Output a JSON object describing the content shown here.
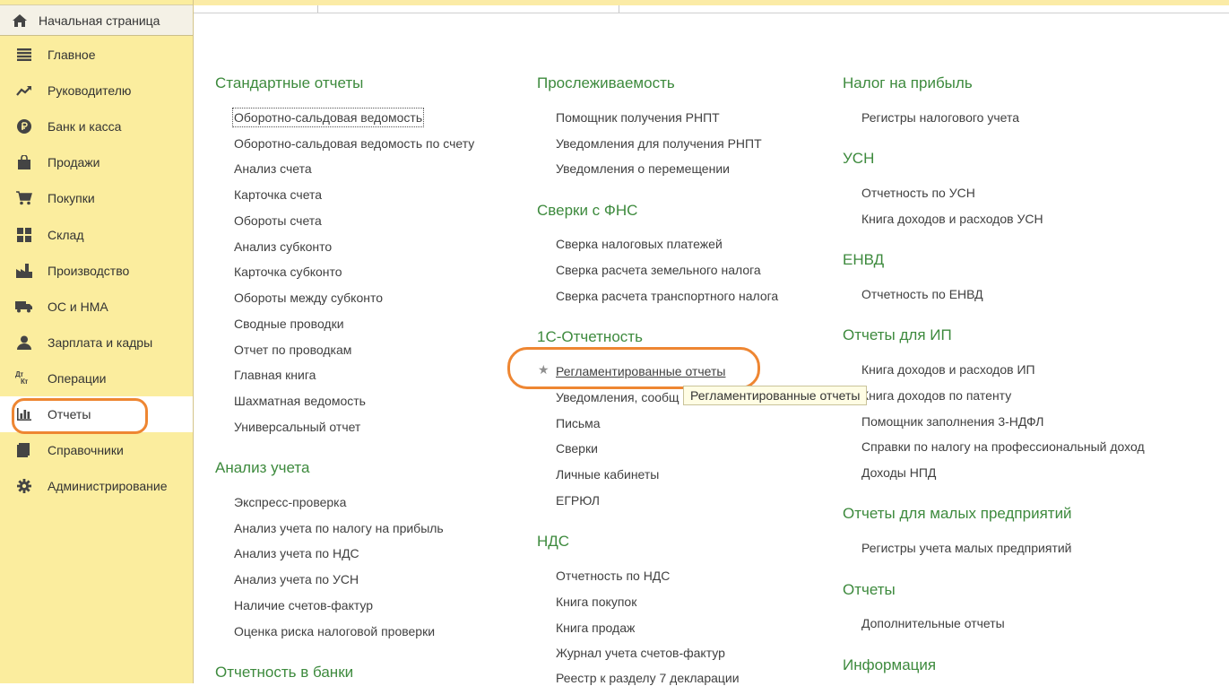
{
  "sidebar": {
    "home_label": "Начальная страница",
    "items": [
      {
        "label": "Главное",
        "icon": "menu-lines-icon"
      },
      {
        "label": "Руководителю",
        "icon": "trend-up-icon"
      },
      {
        "label": "Банк и касса",
        "icon": "ruble-coin-icon"
      },
      {
        "label": "Продажи",
        "icon": "shopping-bag-icon"
      },
      {
        "label": "Покупки",
        "icon": "shopping-cart-icon"
      },
      {
        "label": "Склад",
        "icon": "warehouse-grid-icon"
      },
      {
        "label": "Производство",
        "icon": "factory-icon"
      },
      {
        "label": "ОС и НМА",
        "icon": "truck-icon"
      },
      {
        "label": "Зарплата и кадры",
        "icon": "person-icon"
      },
      {
        "label": "Операции",
        "icon": "debit-credit-icon",
        "icon_text_top": "Дт",
        "icon_text_bottom": "Кт"
      },
      {
        "label": "Отчеты",
        "icon": "bar-chart-icon"
      },
      {
        "label": "Справочники",
        "icon": "books-icon"
      },
      {
        "label": "Администрирование",
        "icon": "gear-icon"
      }
    ],
    "active_item": "Отчеты"
  },
  "columns": [
    {
      "sections": [
        {
          "title": "Стандартные отчеты",
          "links": [
            "Оборотно-сальдовая ведомость",
            "Оборотно-сальдовая ведомость по счету",
            "Анализ счета",
            "Карточка счета",
            "Обороты счета",
            "Анализ субконто",
            "Карточка субконто",
            "Обороты между субконто",
            "Сводные проводки",
            "Отчет по проводкам",
            "Главная книга",
            "Шахматная ведомость",
            "Универсальный отчет"
          ]
        },
        {
          "title": "Анализ учета",
          "links": [
            "Экспресс-проверка",
            "Анализ учета по налогу на прибыль",
            "Анализ учета по НДС",
            "Анализ учета по УСН",
            "Наличие счетов-фактур",
            "Оценка риска налоговой проверки"
          ]
        },
        {
          "title": "Отчетность в банки",
          "links": []
        }
      ]
    },
    {
      "sections": [
        {
          "title": "Прослеживаемость",
          "links": [
            "Помощник получения РНПТ",
            "Уведомления для получения РНПТ",
            "Уведомления о перемещении"
          ]
        },
        {
          "title": "Сверки с ФНС",
          "links": [
            "Сверка налоговых платежей",
            "Сверка расчета земельного налога",
            "Сверка расчета транспортного налога"
          ]
        },
        {
          "title": "1С-Отчетность",
          "links": [
            "Регламентированные отчеты",
            "Уведомления, сообщ",
            "Письма",
            "Сверки",
            "Личные кабинеты",
            "ЕГРЮЛ"
          ]
        },
        {
          "title": "НДС",
          "links": [
            "Отчетность по НДС",
            "Книга покупок",
            "Книга продаж",
            "Журнал учета счетов-фактур",
            "Реестр к разделу 7 декларации"
          ]
        }
      ]
    },
    {
      "sections": [
        {
          "title": "Налог на прибыль",
          "links": [
            "Регистры налогового учета"
          ]
        },
        {
          "title": "УСН",
          "links": [
            "Отчетность по УСН",
            "Книга доходов и расходов УСН"
          ]
        },
        {
          "title": "ЕНВД",
          "links": [
            "Отчетность по ЕНВД"
          ]
        },
        {
          "title": "Отчеты для ИП",
          "links": [
            "Книга доходов и расходов ИП",
            "Книга доходов по патенту",
            "Помощник заполнения 3-НДФЛ",
            "Справки по налогу на профессиональный доход",
            "Доходы НПД"
          ]
        },
        {
          "title": "Отчеты для малых предприятий",
          "links": [
            "Регистры учета малых предприятий"
          ]
        },
        {
          "title": "Отчеты",
          "links": [
            "Дополнительные отчеты"
          ]
        },
        {
          "title": "Информация",
          "links": []
        }
      ]
    }
  ],
  "tooltip": {
    "text": "Регламентированные отчеты"
  },
  "colors": {
    "sidebar_bg": "#fbed9e",
    "section_title": "#3d8a3d",
    "highlight": "#ee8632",
    "tooltip_bg": "#fffde4"
  }
}
